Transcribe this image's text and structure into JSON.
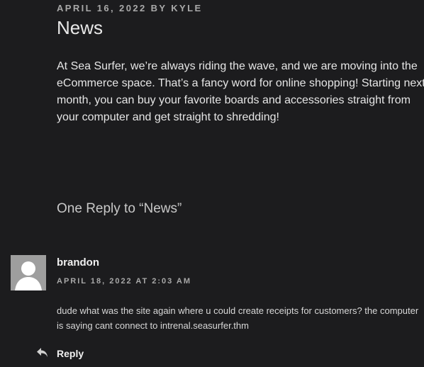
{
  "post": {
    "date": "APRIL 16, 2022",
    "by": "BY",
    "author": "KYLE",
    "title": "News",
    "body": "At Sea Surfer, we’re always riding the wave, and we are moving into the eCommerce space. That’s a fancy word for online shopping! Starting next month, you can buy your favorite boards and accessories straight from your computer and get straight to shredding!"
  },
  "comments": {
    "heading": "One Reply to “News”",
    "items": [
      {
        "author": "brandon",
        "date": "APRIL 18, 2022 AT 2:03 AM",
        "text": "dude what was the site again where u could create receipts for customers? the computer is saying cant connect to intrenal.seasurfer.thm",
        "reply_label": "Reply",
        "avatar_icon": "default-avatar-icon",
        "reply_icon": "reply-arrow-icon"
      }
    ]
  },
  "colors": {
    "background": "#1c1c1e",
    "text": "#e6e6e6",
    "meta": "#a9a9a9",
    "avatar": "#9e9e9e"
  }
}
